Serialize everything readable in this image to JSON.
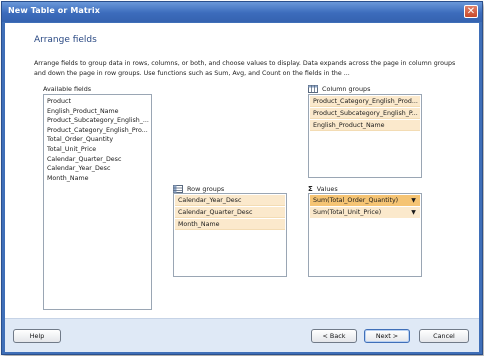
{
  "window": {
    "title": "New Table or Matrix",
    "close_glyph": "✕"
  },
  "page": {
    "heading": "Arrange fields",
    "description": "Arrange fields to group data in rows, columns, or both, and choose values to display. Data expands across the page in column groups and down the page in row groups.  Use functions such as Sum, Avg, and Count on the fields in the ..."
  },
  "available_fields": {
    "label": "Available fields",
    "items": [
      "Product",
      "English_Product_Name",
      "Product_Subcategory_English_...",
      "Product_Category_English_Pro...",
      "Total_Order_Quantity",
      "Total_Unit_Price",
      "Calendar_Quarter_Desc",
      "Calendar_Year_Desc",
      "Month_Name"
    ]
  },
  "column_groups": {
    "label": "Column groups",
    "icon": "column-groups-icon",
    "items": [
      "Product_Category_English_Prod...",
      "Product_Subcategory_English_P...",
      "English_Product_Name"
    ]
  },
  "row_groups": {
    "label": "Row groups",
    "icon": "row-groups-icon",
    "items": [
      "Calendar_Year_Desc",
      "Calendar_Quarter_Desc",
      "Month_Name"
    ]
  },
  "values": {
    "label": "Values",
    "icon_glyph": "Σ",
    "items": [
      {
        "text": "Sum(Total_Order_Quantity)",
        "selected": true
      },
      {
        "text": "Sum(Total_Unit_Price)",
        "selected": false
      }
    ],
    "dropdown_glyph": "▼"
  },
  "buttons": {
    "help": "Help",
    "back": "< Back",
    "next": "Next >",
    "cancel": "Cancel"
  },
  "colors": {
    "title_bar": "#3c6cbc",
    "heading": "#2b4a84",
    "zone_item": "#fbe9cc",
    "selected_item": "#f5c474",
    "footer": "#dfe9f6"
  }
}
